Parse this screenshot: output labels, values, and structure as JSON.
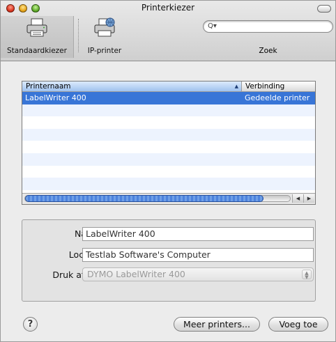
{
  "window": {
    "title": "Printerkiezer"
  },
  "toolbar": {
    "items": [
      {
        "label": "Standaardkiezer",
        "icon": "printer-icon",
        "selected": true
      },
      {
        "label": "IP-printer",
        "icon": "network-printer-icon",
        "selected": false
      }
    ],
    "search": {
      "label": "Zoek",
      "value": ""
    }
  },
  "printer_list": {
    "columns": [
      "Printernaam",
      "Verbinding"
    ],
    "sort_column": "Printernaam",
    "sort_direction": "ascending",
    "rows": [
      {
        "name": "LabelWriter 400",
        "connection": "Gedeelde printer",
        "selected": true
      }
    ]
  },
  "details": {
    "name_label": "Naam:",
    "name_value": "LabelWriter 400",
    "location_label": "Locatie:",
    "location_value": "Testlab Software's Computer",
    "print_via_label": "Druk af via:",
    "print_via_value": "DYMO LabelWriter 400"
  },
  "buttons": {
    "help": "?",
    "more_printers": "Meer printers...",
    "add": "Voeg toe"
  },
  "colors": {
    "selection": "#3875d7",
    "scroll_thumb": "#4d83dd"
  }
}
